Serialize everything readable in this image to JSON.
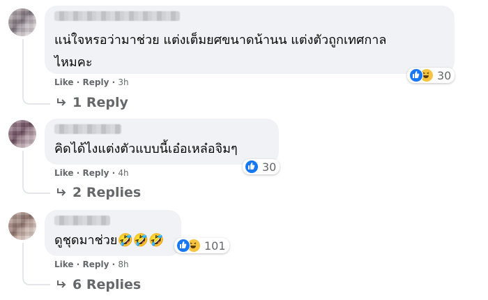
{
  "comments": [
    {
      "text_line1": "แน่ใจหรอว่ามาช่วย แต่งเต็มยศขนาดน้านน แต่งตัวถูกเทศกาล",
      "text_line2": "ไหมคะ",
      "reaction_icons": [
        "like-icon",
        "haha-icon"
      ],
      "reaction_count": "30",
      "like_label": "Like",
      "reply_label": "Reply",
      "separator": "·",
      "time": "3h",
      "replies_label": "1 Reply"
    },
    {
      "text_line1": "คิดได้ไงแต่งตัวแบบนี้เอ๋อเหล๋อจิมๆ",
      "reaction_icons": [
        "like-icon"
      ],
      "reaction_count": "30",
      "like_label": "Like",
      "reply_label": "Reply",
      "separator": "·",
      "time": "4h",
      "replies_label": "2 Replies"
    },
    {
      "text_line1": "ดูชุดมาช่วย🤣🤣🤣",
      "reaction_icons": [
        "like-icon",
        "haha-icon"
      ],
      "reaction_count": "101",
      "like_label": "Like",
      "reply_label": "Reply",
      "separator": "·",
      "time": "8h",
      "replies_label": "6 Replies"
    }
  ],
  "colors": {
    "bubble": "#f0f2f5",
    "secondary_text": "#65676b",
    "like_blue": "#1877f2",
    "haha_yellow": "#f7c441"
  }
}
